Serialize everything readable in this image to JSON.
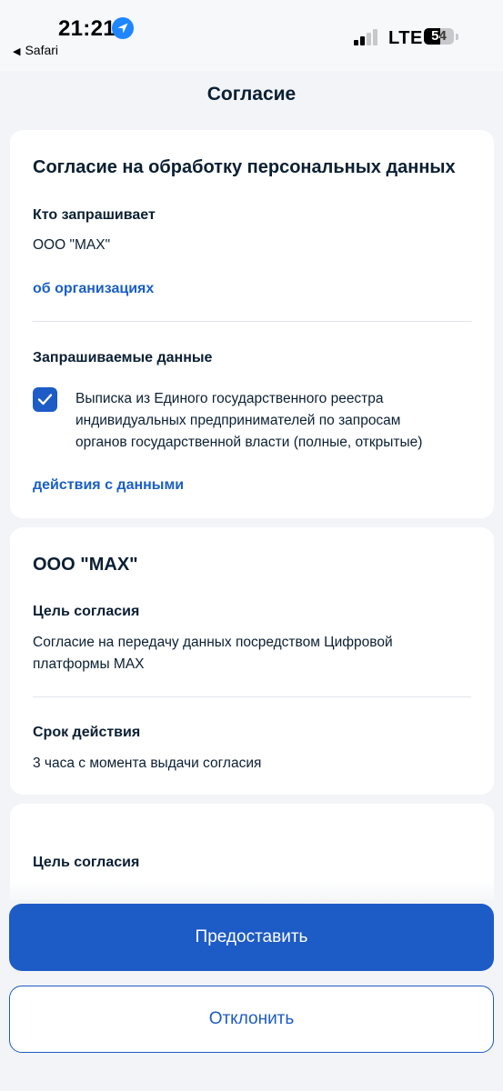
{
  "status_bar": {
    "time": "21:21",
    "back_app": "Safari",
    "network": "LTE",
    "battery_percent": "54",
    "battery_level": 0.54
  },
  "header": {
    "title": "Согласие"
  },
  "consent_card": {
    "title": "Согласие на обработку персональных данных",
    "requester_label": "Кто запрашивает",
    "requester_value": "ООО \"MAX\"",
    "org_link": "об организациях",
    "data_label": "Запрашиваемые данные",
    "data_item": {
      "checked": true,
      "lines": [
        "Выписка из Единого государственного реестра",
        "индивидуальных предпринимателей по запросам",
        "органов государственной власти (полные, открытые)"
      ]
    },
    "actions_link": "действия с данными"
  },
  "org_card": {
    "title": "ООО \"MAX\"",
    "purpose_label": "Цель согласия",
    "purpose_lines": [
      "Согласие на передачу данных посредством Цифровой",
      "платформы MAX"
    ],
    "term_label": "Срок действия",
    "term_value": "3 часа с момента выдачи согласия"
  },
  "partial_card": {
    "purpose_label": "Цель согласия"
  },
  "actions": {
    "grant_label": "Предоставить",
    "decline_label": "Отклонить"
  },
  "colors": {
    "accent": "#1d5bc6",
    "link": "#1a5fc6",
    "background": "#f2f4f7",
    "text": "#0b1f33"
  }
}
